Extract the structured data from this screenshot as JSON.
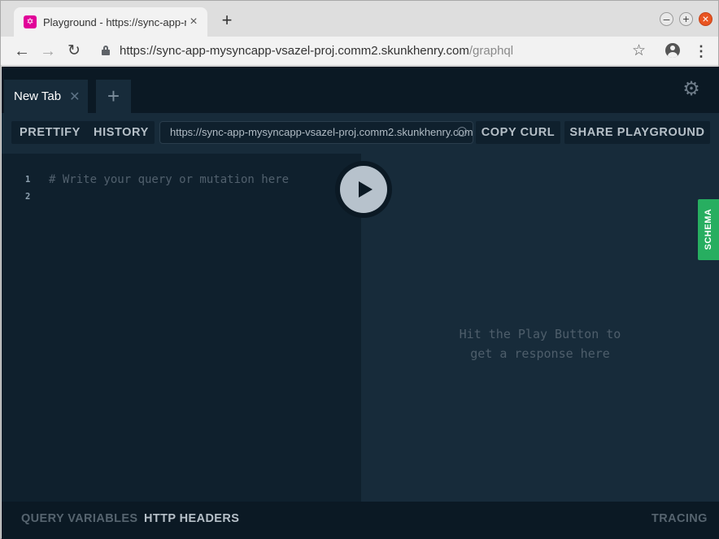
{
  "browser": {
    "tab_title": "Playground - https://sync-app-m",
    "favicon_icon": "graphql-icon",
    "url_host": "https://sync-app-mysyncapp-vsazel-proj.comm2.skunkhenry.com",
    "url_path": "/graphql"
  },
  "playground": {
    "tab_label": "New Tab",
    "prettify_label": "PRETTIFY",
    "history_label": "HISTORY",
    "endpoint_value": "https://sync-app-mysyncapp-vsazel-proj.comm2.skunkhenry.com",
    "copy_curl_label": "COPY CURL",
    "share_label": "SHARE PLAYGROUND",
    "line_numbers": [
      "1",
      "2"
    ],
    "editor_placeholder": "# Write your query or mutation here",
    "result_hint_line1": "Hit the Play Button to",
    "result_hint_line2": "get a response here",
    "schema_label": "SCHEMA",
    "query_variables_label": "QUERY VARIABLES",
    "http_headers_label": "HTTP HEADERS",
    "tracing_label": "TRACING"
  },
  "colors": {
    "app_background": "#0f202d",
    "panel": "#172b3a",
    "schema_green": "#27ae60",
    "graphql_pink": "#e10098"
  }
}
